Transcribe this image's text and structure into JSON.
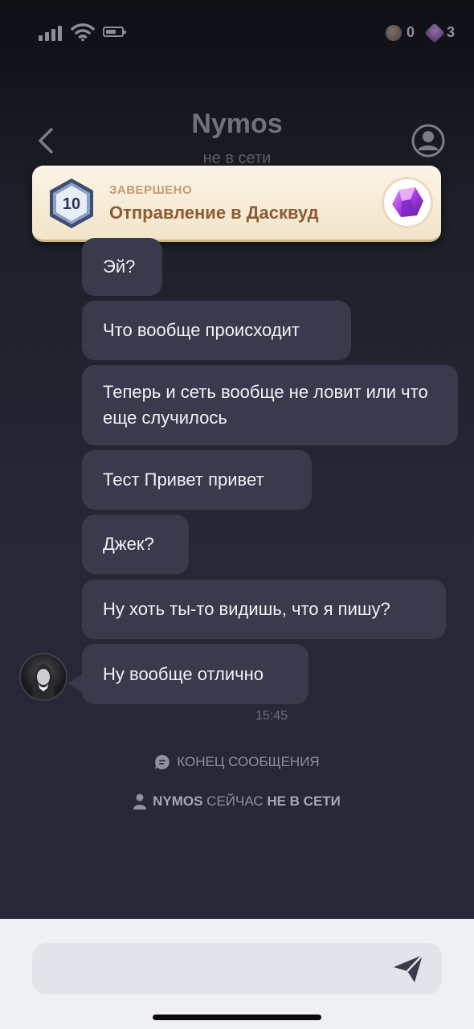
{
  "status_bar": {
    "coins_count": "0",
    "gems_count": "3"
  },
  "header": {
    "contact_name": "Nymos",
    "contact_status": "не в сети"
  },
  "banner": {
    "level": "10",
    "status": "ЗАВЕРШЕНО",
    "title": "Отправление в Дасквуд"
  },
  "messages": [
    {
      "text": "Эй?"
    },
    {
      "text": "Что вообще происходит"
    },
    {
      "text": "Теперь и сеть вообще не ловит или что еще случилось"
    },
    {
      "text": "Тест Привет привет"
    },
    {
      "text": "Джек?"
    },
    {
      "text": "Ну хоть ты-то видишь, что я пишу?"
    },
    {
      "text": "Ну вообще отлично"
    }
  ],
  "last_message_time": "15:45",
  "system": {
    "end_of_messages": "КОНЕЦ СООБЩЕНИЯ",
    "offline_name": "NYMOS",
    "offline_mid": "СЕЙЧАС",
    "offline_state": "НЕ В СЕТИ"
  },
  "composer": {
    "placeholder": ""
  },
  "colors": {
    "bubble": "#393b4d",
    "banner_bg": "#f7eddb",
    "banner_title": "#8b5b34",
    "banner_status": "#c59a73",
    "input_bg": "#eff0f4"
  },
  "icons": [
    "signal-icon",
    "wifi-icon",
    "battery-icon",
    "coin-icon",
    "gem-icon",
    "back-arrow-icon",
    "profile-icon",
    "level-badge-icon",
    "purple-gem-icon",
    "avatar",
    "chat-bubble-icon",
    "person-icon",
    "send-icon"
  ]
}
